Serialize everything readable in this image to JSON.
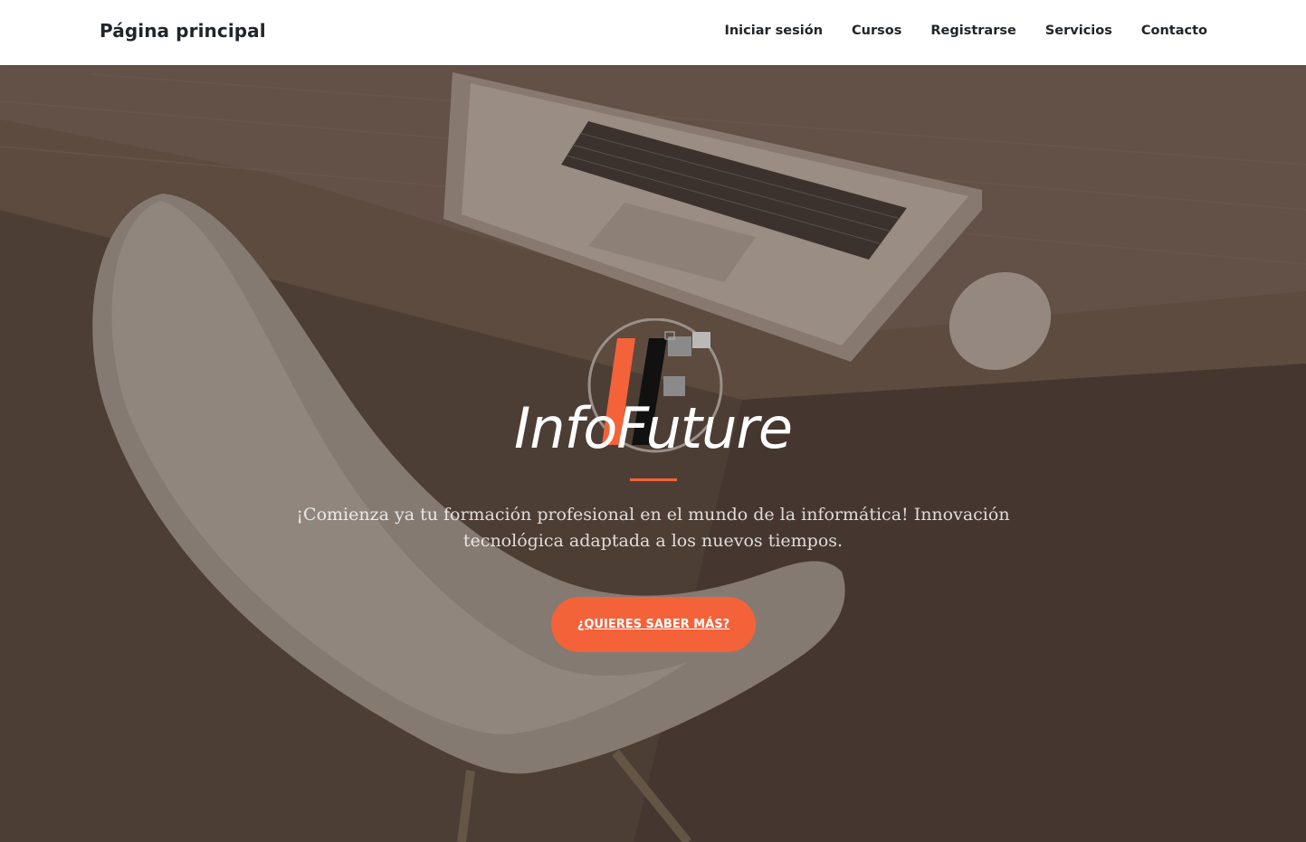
{
  "navbar": {
    "brand": "Página principal",
    "links": [
      {
        "label": "Iniciar sesión"
      },
      {
        "label": "Cursos"
      },
      {
        "label": "Registrarse"
      },
      {
        "label": "Servicios"
      },
      {
        "label": "Contacto"
      }
    ]
  },
  "hero": {
    "logo_icon": "infofuture-logo",
    "title": "InfoFuture",
    "subtitle": "¡Comienza ya tu formación profesional en el mundo de la informática! Innovación tecnológica adaptada a los nuevos tiempos.",
    "cta_label": "¿Quieres saber más?",
    "background_image": "desk-laptop-chair-photo"
  },
  "colors": {
    "accent": "#f4623a",
    "overlay": "#4d3e35",
    "navbar_bg": "#ffffff",
    "text_dark": "#212529"
  }
}
